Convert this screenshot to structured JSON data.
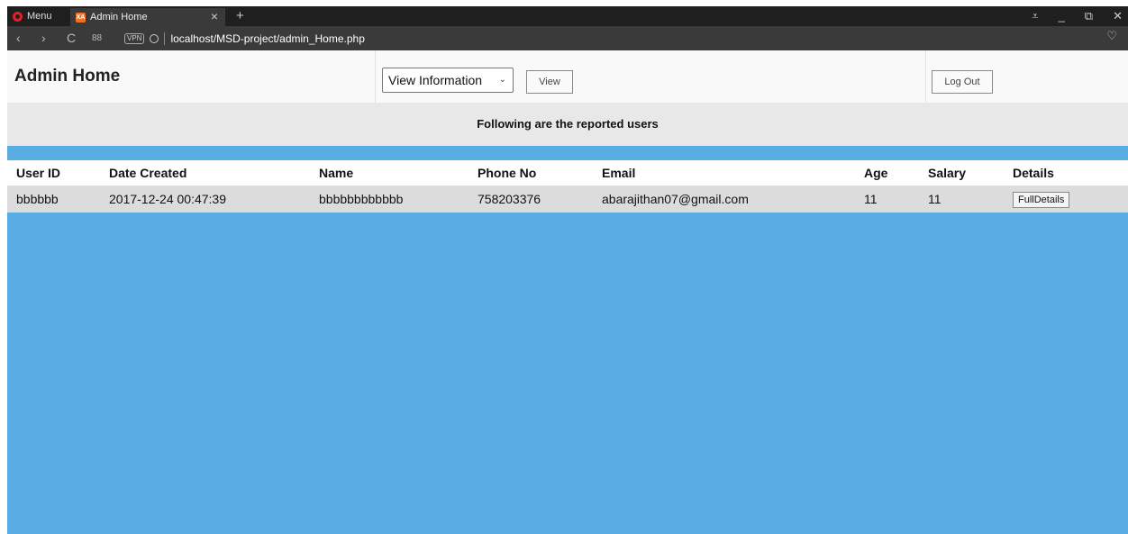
{
  "browser": {
    "menu_label": "Menu",
    "tab_title": "Admin Home",
    "favicon_text": "XA",
    "close_glyph": "×",
    "new_tab_glyph": "+",
    "back_glyph": "‹",
    "forward_glyph": "›",
    "reload_glyph": "C",
    "speed_dial_glyph": "88",
    "vpn_label": "VPN",
    "url": "localhost/MSD-project/admin_Home.php",
    "heart_glyph": "♡",
    "win_glyphs": [
      "⩡",
      "_",
      "⧉",
      "✕"
    ]
  },
  "header": {
    "title": "Admin Home",
    "select_value": "View Information",
    "select_chevron": "⌄",
    "view_button": "View",
    "logout_button": "Log Out"
  },
  "subtitle": "Following are the reported users",
  "table": {
    "columns": [
      "User ID",
      "Date Created",
      "Name",
      "Phone No",
      "Email",
      "Age",
      "Salary",
      "Details"
    ],
    "rows": [
      {
        "user_id": "bbbbbb",
        "date_created": "2017-12-24 00:47:39",
        "name": "bbbbbbbbbbbb",
        "phone": "758203376",
        "email": "abarajithan07@gmail.com",
        "age": "11",
        "salary": "11",
        "details_button": "FullDetails"
      }
    ]
  },
  "colors": {
    "page_background": "#5aace4",
    "header_background": "#f9f9f9",
    "subbar_background": "#e8e8e8",
    "row_background": "#dcdcdc"
  }
}
